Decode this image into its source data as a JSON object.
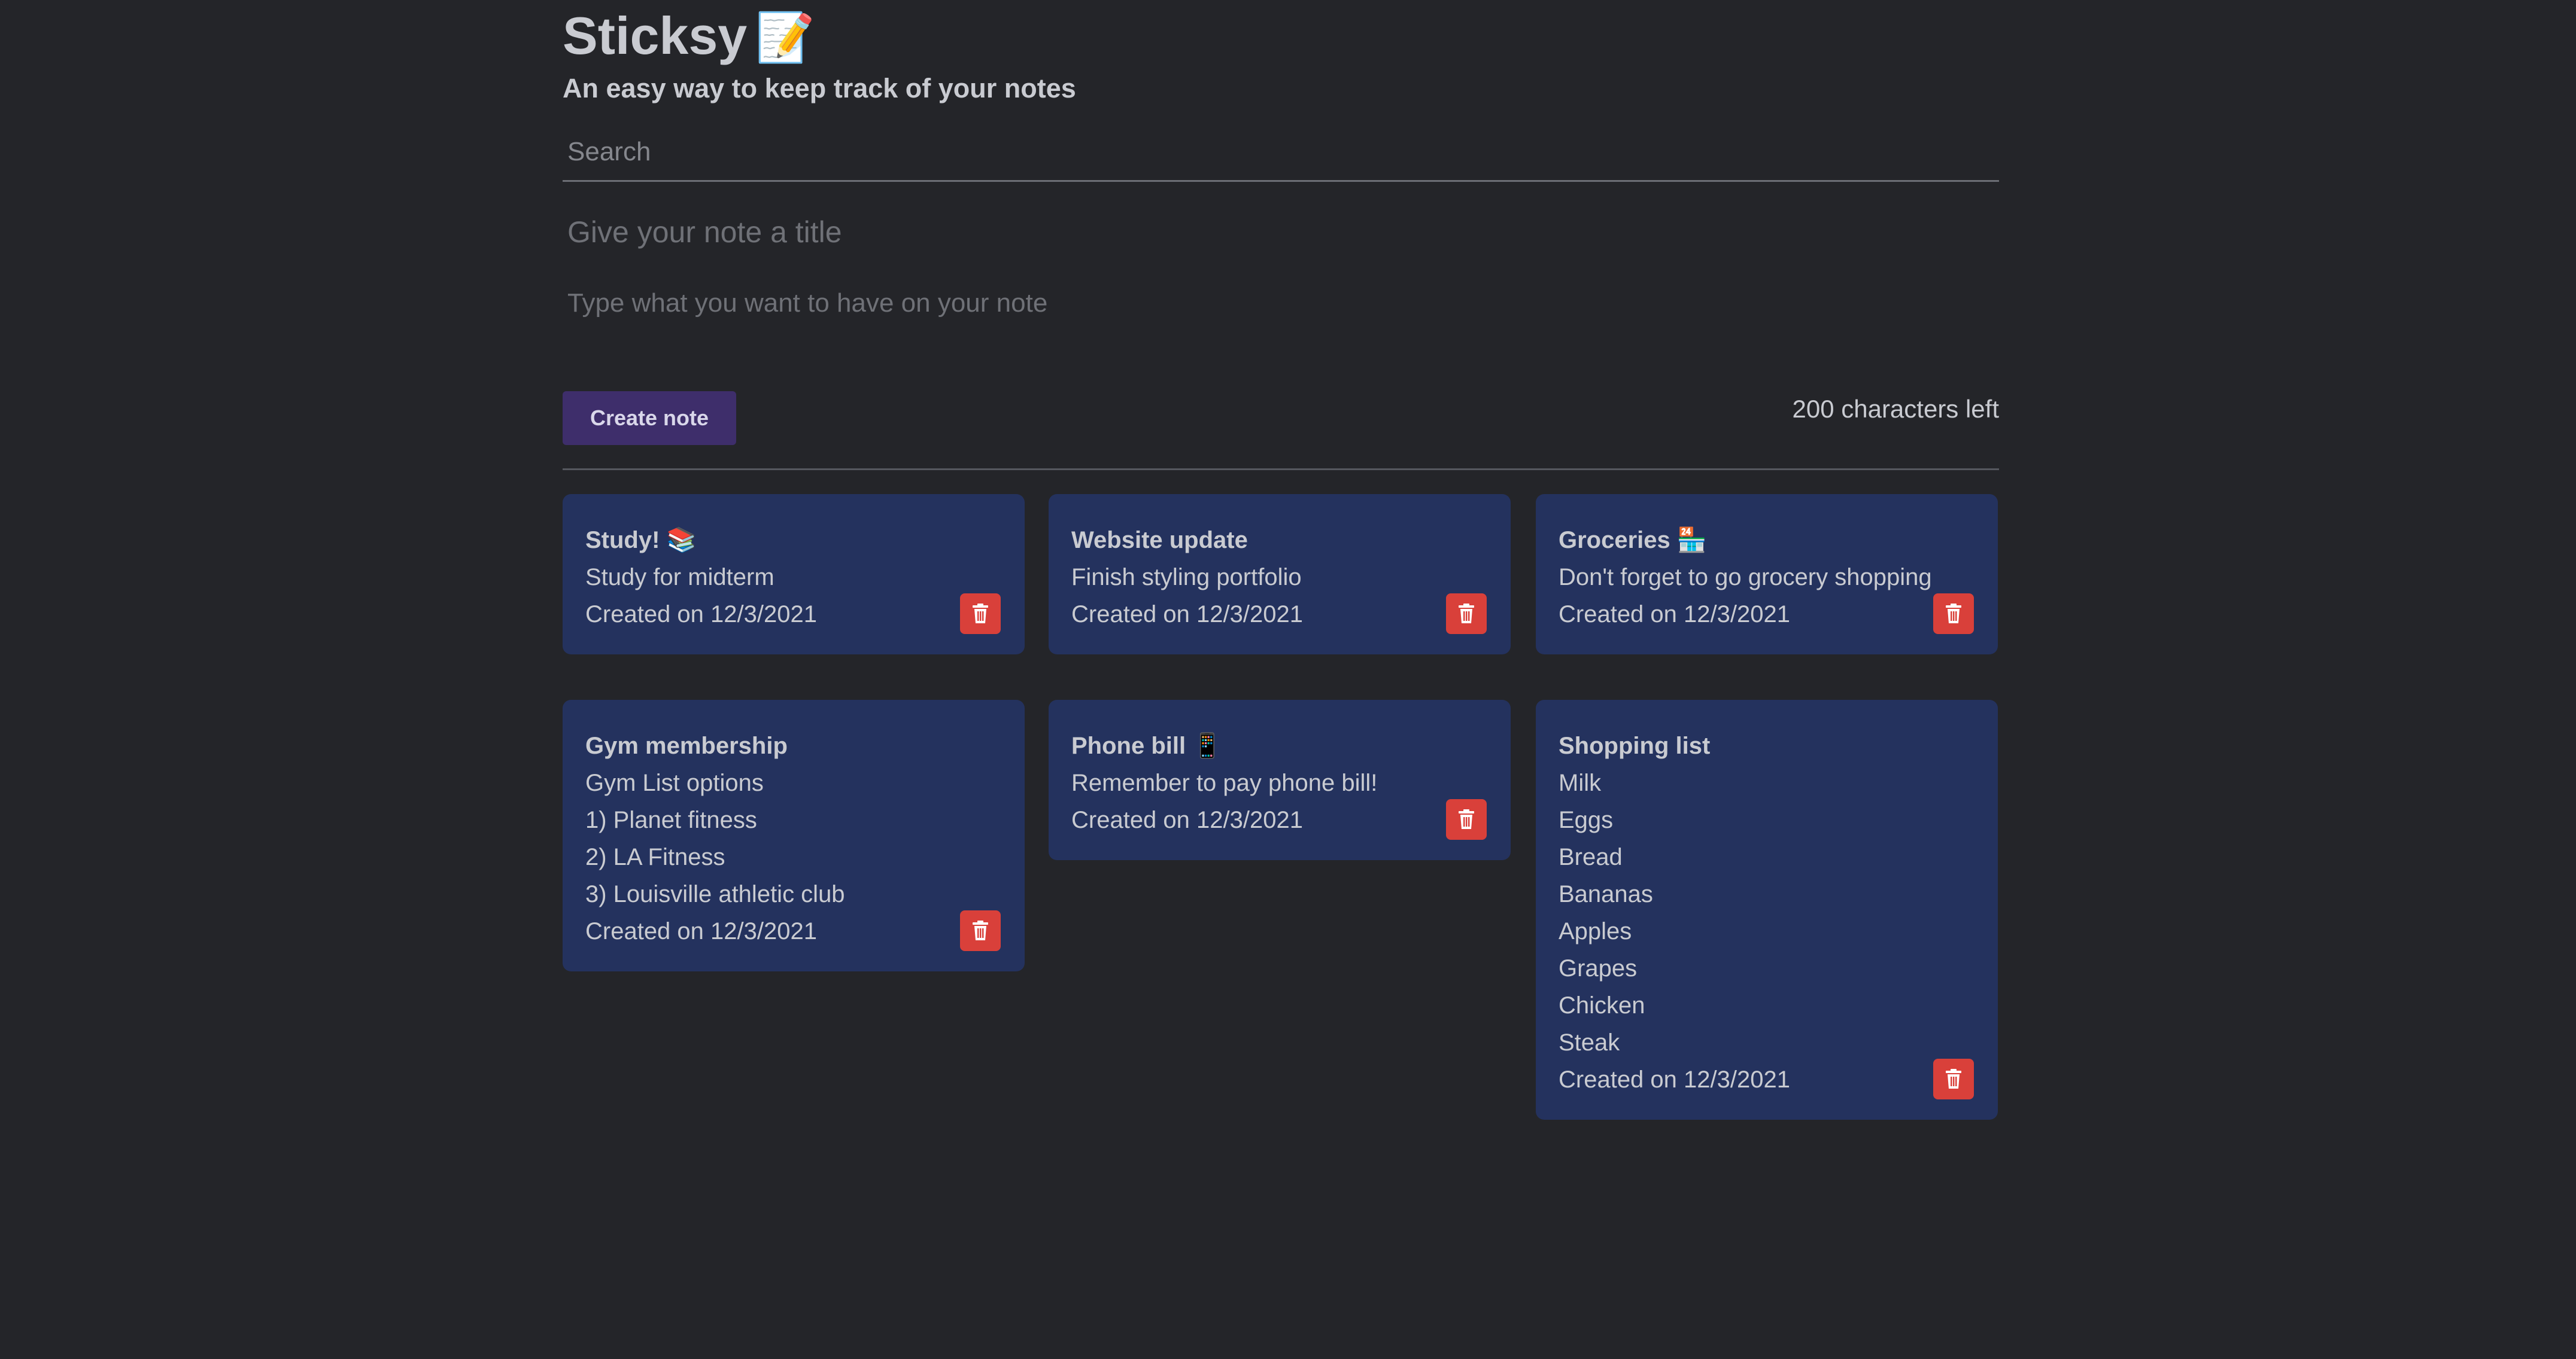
{
  "header": {
    "title": "Sticksy",
    "title_emoji": "📝",
    "subtitle": "An easy way to keep track of your notes"
  },
  "search": {
    "placeholder": "Search",
    "value": ""
  },
  "composer": {
    "title_placeholder": "Give your note a title",
    "body_placeholder": "Type what you want to have on your note",
    "create_label": "Create note",
    "chars_left": "200 characters left"
  },
  "colors": {
    "background": "#242529",
    "note_card": "#24325e",
    "create_button": "#3e2e6b",
    "delete_button": "#d9403a"
  },
  "notes": [
    {
      "title": "Study! 📚",
      "lines": [
        "Study for midterm"
      ],
      "date": "Created on 12/3/2021",
      "delete_icon": "trash-icon"
    },
    {
      "title": "Website update",
      "lines": [
        "Finish styling portfolio"
      ],
      "date": "Created on 12/3/2021",
      "delete_icon": "trash-icon"
    },
    {
      "title": "Groceries 🏪",
      "lines": [
        "Don't forget to go grocery shopping"
      ],
      "date": "Created on 12/3/2021",
      "delete_icon": "trash-icon"
    },
    {
      "title": "Gym membership",
      "lines": [
        "Gym List options",
        "1) Planet fitness",
        "2) LA Fitness",
        "3) Louisville athletic club"
      ],
      "date": "Created on 12/3/2021",
      "delete_icon": "trash-icon"
    },
    {
      "title": "Phone bill 📱",
      "lines": [
        "Remember to pay phone bill!"
      ],
      "date": "Created on 12/3/2021",
      "delete_icon": "trash-icon"
    },
    {
      "title": "Shopping list",
      "lines": [
        "Milk",
        "Eggs",
        "Bread",
        "Bananas",
        "Apples",
        "Grapes",
        "Chicken",
        "Steak"
      ],
      "date": "Created on 12/3/2021",
      "delete_icon": "trash-icon"
    }
  ]
}
